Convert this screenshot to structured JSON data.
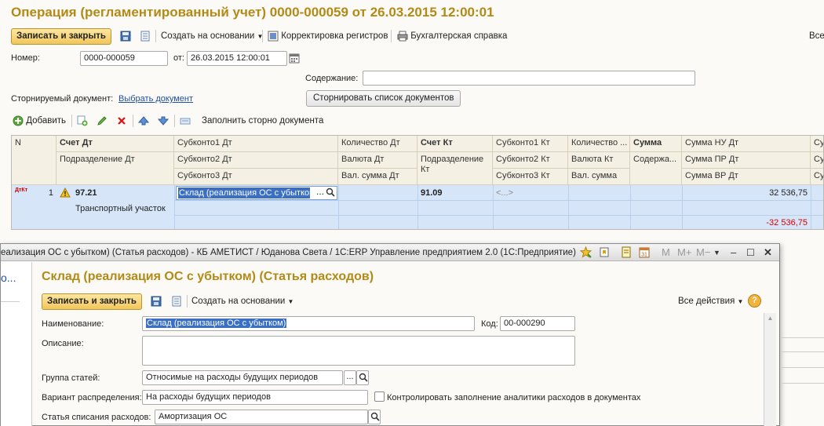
{
  "doc": {
    "title": "Операция (регламентированный учет) 0000-000059 от 26.03.2015 12:00:01",
    "toolbar": {
      "save_close": "Записать и закрыть",
      "create_based": "Создать на основании",
      "registers": "Корректировка регистров",
      "accounting_ref": "Бухгалтерская справка",
      "all_actions": "Все"
    },
    "number_label": "Номер:",
    "number_value": "0000-000059",
    "date_label": "от:",
    "date_value": "26.03.2015 12:00:01",
    "content_label": "Содержание:",
    "content_value": "",
    "storno_label": "Сторнируемый документ:",
    "storno_link": "Выбрать документ",
    "storno_list_button": "Сторнировать список документов",
    "grid_toolbar": {
      "add": "Добавить",
      "fill_storno": "Заполнить сторно документа"
    },
    "grid": {
      "headers": {
        "n": "N",
        "debit_account": "Счет Дт",
        "debit_division": "Подразделение Дт",
        "subkonto1_dt": "Субконто1 Дт",
        "subkonto2_dt": "Субконто2 Дт",
        "subkonto3_dt": "Субконто3 Дт",
        "qty_dt": "Количество Дт",
        "currency_dt": "Валюта Дт",
        "cur_sum_dt": "Вал. сумма Дт",
        "credit_account": "Счет Кт",
        "credit_division": "Подразделение Кт",
        "subkonto1_kt": "Субконто1 Кт",
        "subkonto2_kt": "Субконто2 Кт",
        "subkonto3_kt": "Субконто3 Кт",
        "qty_kt": "Количество ...",
        "currency_kt": "Валюта Кт",
        "cur_sum_kt": "Вал. сумма",
        "sum": "Сумма",
        "content": "Содержа...",
        "sum_nu_dt": "Сумма НУ Дт",
        "sum_pr_dt": "Сумма ПР Дт",
        "sum_vr_dt": "Сумма ВР Дт",
        "cut1": "Сум",
        "cut2": "Сум",
        "cut3": "Сум"
      },
      "row": {
        "dt_kt_icon": "ДтКт",
        "n": "1",
        "debit_account": "97.21",
        "debit_division": "Транспортный участок",
        "subkonto1_dt": "Склад (реализация ОС с убытком",
        "credit_account": "91.09",
        "subkonto1_kt": "<...>",
        "sum_nu_dt": "32 536,75",
        "sum_vr_dt": "-32 536,75"
      }
    }
  },
  "dialog": {
    "window_title": "еализация ОС с убытком) (Статья расходов) - КБ АМЕТИСТ / Юданова Света / 1С:ERP Управление предприятием 2.0  (1С:Предприятие)",
    "heading": "Склад (реализация ОС с убытком) (Статья расходов)",
    "left_stub": "о...",
    "toolbar": {
      "save_close": "Записать и закрыть",
      "create_based": "Создать на основании",
      "all_actions": "Все действия"
    },
    "name_label": "Наименование:",
    "name_value": "Склад (реализация ОС с убытком)",
    "code_label": "Код:",
    "code_value": "00-000290",
    "description_label": "Описание:",
    "description_value": "",
    "group_label": "Группа статей:",
    "group_value": "Относимые на расходы будущих периодов",
    "distribution_label": "Вариант распределения:",
    "distribution_value": "На расходы будущих периодов",
    "control_checkbox_label": "Контролировать заполнение аналитики расходов в документах",
    "control_checked": false,
    "writeoff_label": "Статья списания расходов:",
    "writeoff_value": "Амортизация ОС",
    "title_buttons": {
      "m": "M",
      "mplus": "M+",
      "mminus": "M−"
    }
  },
  "colors": {
    "title": "#b38a16",
    "accent_button": "#f1c65b",
    "selection": "#d6e6f8",
    "negative": "#d40000",
    "link": "#1f4ea3"
  }
}
